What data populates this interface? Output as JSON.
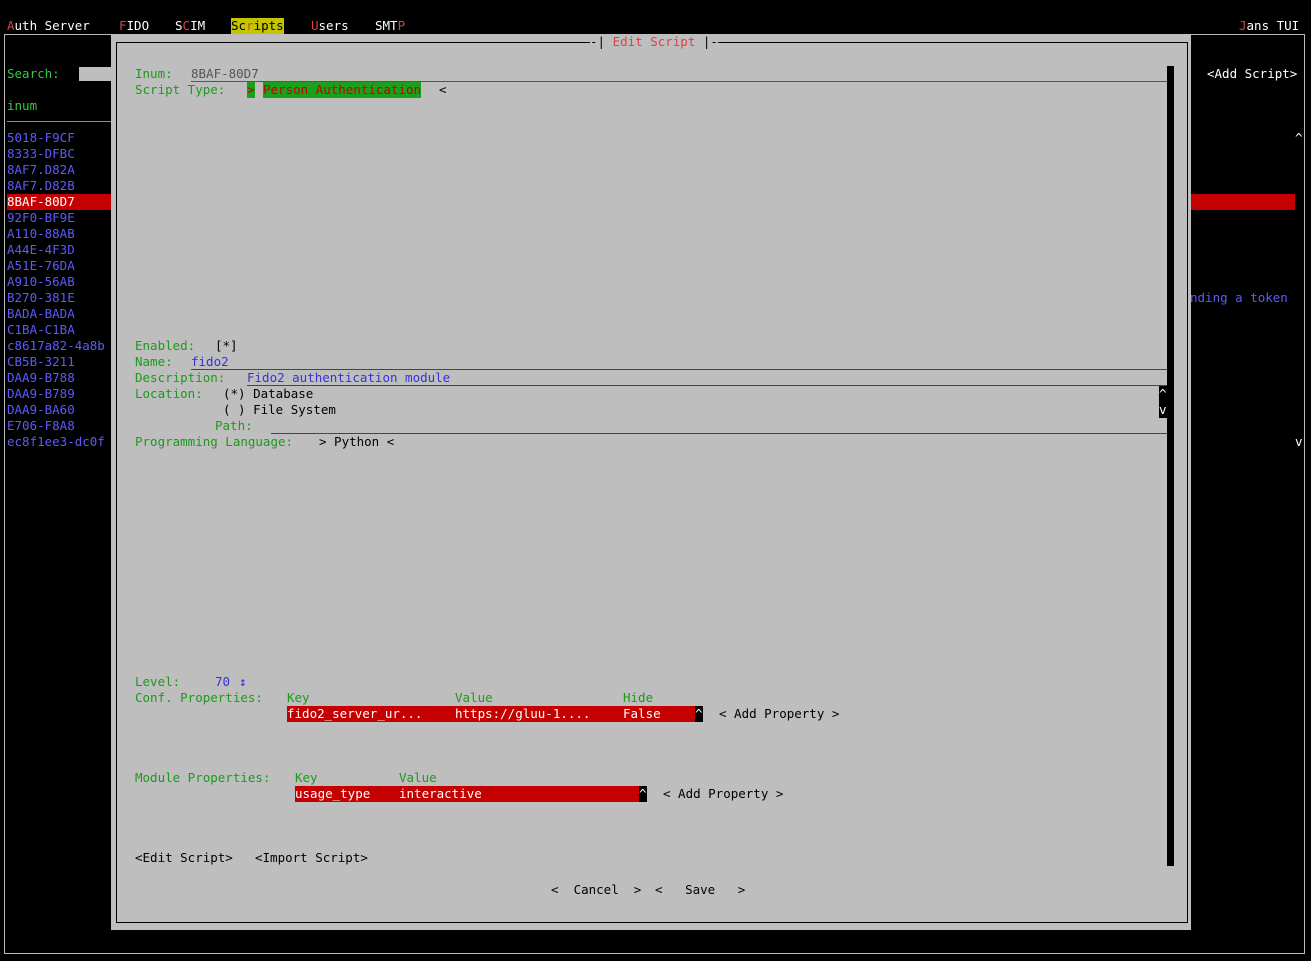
{
  "topbar": {
    "menus": [
      {
        "hot": "A",
        "rest": "uth Server"
      },
      {
        "hot": "F",
        "rest": "IDO"
      },
      {
        "pre": "S",
        "hot": "C",
        "rest": "IM"
      },
      {
        "pre": "Sc",
        "hot": "r",
        "rest": "ipts"
      },
      {
        "hot": "U",
        "rest": "sers"
      },
      {
        "pre": "SMT",
        "hot": "P",
        "rest": ""
      }
    ],
    "app_prefix": "",
    "app_hot": "J",
    "app_rest": "ans TUI"
  },
  "sidebar": {
    "search_label": "Search:",
    "column_header": "inum",
    "items": [
      "5018-F9CF",
      "8333-DFBC",
      "8AF7.D82A",
      "8AF7.D82B",
      "8BAF-80D7",
      "92F0-BF9E",
      "A110-88AB",
      "A44E-4F3D",
      "A51E-76DA",
      "A910-56AB",
      "B270-381E",
      "BADA-BADA",
      "C1BA-C1BA",
      "c8617a82-4a8b",
      "CB5B-3211",
      "DAA9-B788",
      "DAA9-B789",
      "DAA9-BA60",
      "E706-F8A8",
      "ec8f1ee3-dc0f"
    ],
    "selected_index": 4
  },
  "right_panel": {
    "add_script": "<Add Script>",
    "scroll_up": "^",
    "scroll_down": "v",
    "partial_text": "nding a token"
  },
  "dialog": {
    "title": "Edit Script",
    "inum_label": "Inum:",
    "inum_value": "8BAF-80D7",
    "script_type_label": "Script Type:",
    "script_type_arrow": ">",
    "script_type_value": "Person Authentication",
    "script_type_close": "<",
    "enabled_label": "Enabled:",
    "enabled_value": "[*]",
    "name_label": "Name:",
    "name_value": "fido2",
    "description_label": "Description:",
    "description_value": "Fido2 authentication module",
    "location_label": "Location:",
    "location_options": [
      "(*) Database",
      "( ) File System"
    ],
    "path_label": "Path:",
    "language_label": "Programming Language:",
    "language_value": "> Python <",
    "level_label": "Level:",
    "level_value": "70",
    "level_icon": "↕",
    "conf_label": "Conf. Properties:",
    "conf_headers": [
      "Key",
      "Value",
      "Hide"
    ],
    "conf_rows": [
      {
        "key": "fido2_server_ur...",
        "value": "https://gluu-1....",
        "hide": "False"
      }
    ],
    "module_label": "Module Properties:",
    "module_headers": [
      "Key",
      "Value"
    ],
    "module_rows": [
      {
        "key": "usage_type",
        "value": "interactive"
      }
    ],
    "add_property": "< Add Property >",
    "scroll_up": "^",
    "scroll_down": "v",
    "edit_script_btn": "<Edit Script>",
    "import_script_btn": "<Import Script>",
    "cancel_btn": "<  Cancel  >",
    "save_btn": "<   Save   >"
  }
}
